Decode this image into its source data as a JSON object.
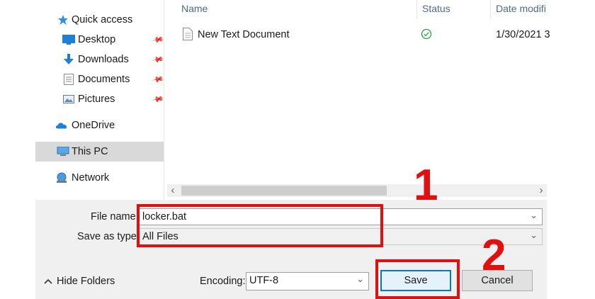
{
  "nav": {
    "items": [
      {
        "label": "Quick access",
        "icon": "star-icon"
      },
      {
        "label": "Desktop",
        "icon": "desktop-icon"
      },
      {
        "label": "Downloads",
        "icon": "download-icon"
      },
      {
        "label": "Documents",
        "icon": "documents-icon"
      },
      {
        "label": "Pictures",
        "icon": "pictures-icon"
      },
      {
        "label": "OneDrive",
        "icon": "cloud-icon"
      },
      {
        "label": "This PC",
        "icon": "computer-icon"
      },
      {
        "label": "Network",
        "icon": "network-icon"
      }
    ]
  },
  "list": {
    "columns": {
      "name": "Name",
      "status": "Status",
      "date": "Date modifi"
    },
    "rows": [
      {
        "name": "New Text Document",
        "date": "1/30/2021 3"
      }
    ]
  },
  "form": {
    "filename_label": "File name:",
    "filename_value": "locker.bat",
    "type_label": "Save as type:",
    "type_value": "All Files",
    "encoding_label": "Encoding:",
    "encoding_value": "UTF-8",
    "save_label": "Save",
    "cancel_label": "Cancel",
    "hide_folders_label": "Hide Folders"
  },
  "annotations": {
    "one": "1",
    "two": "2"
  },
  "colors": {
    "annotation": "#e01010",
    "accent": "#0078d7"
  }
}
